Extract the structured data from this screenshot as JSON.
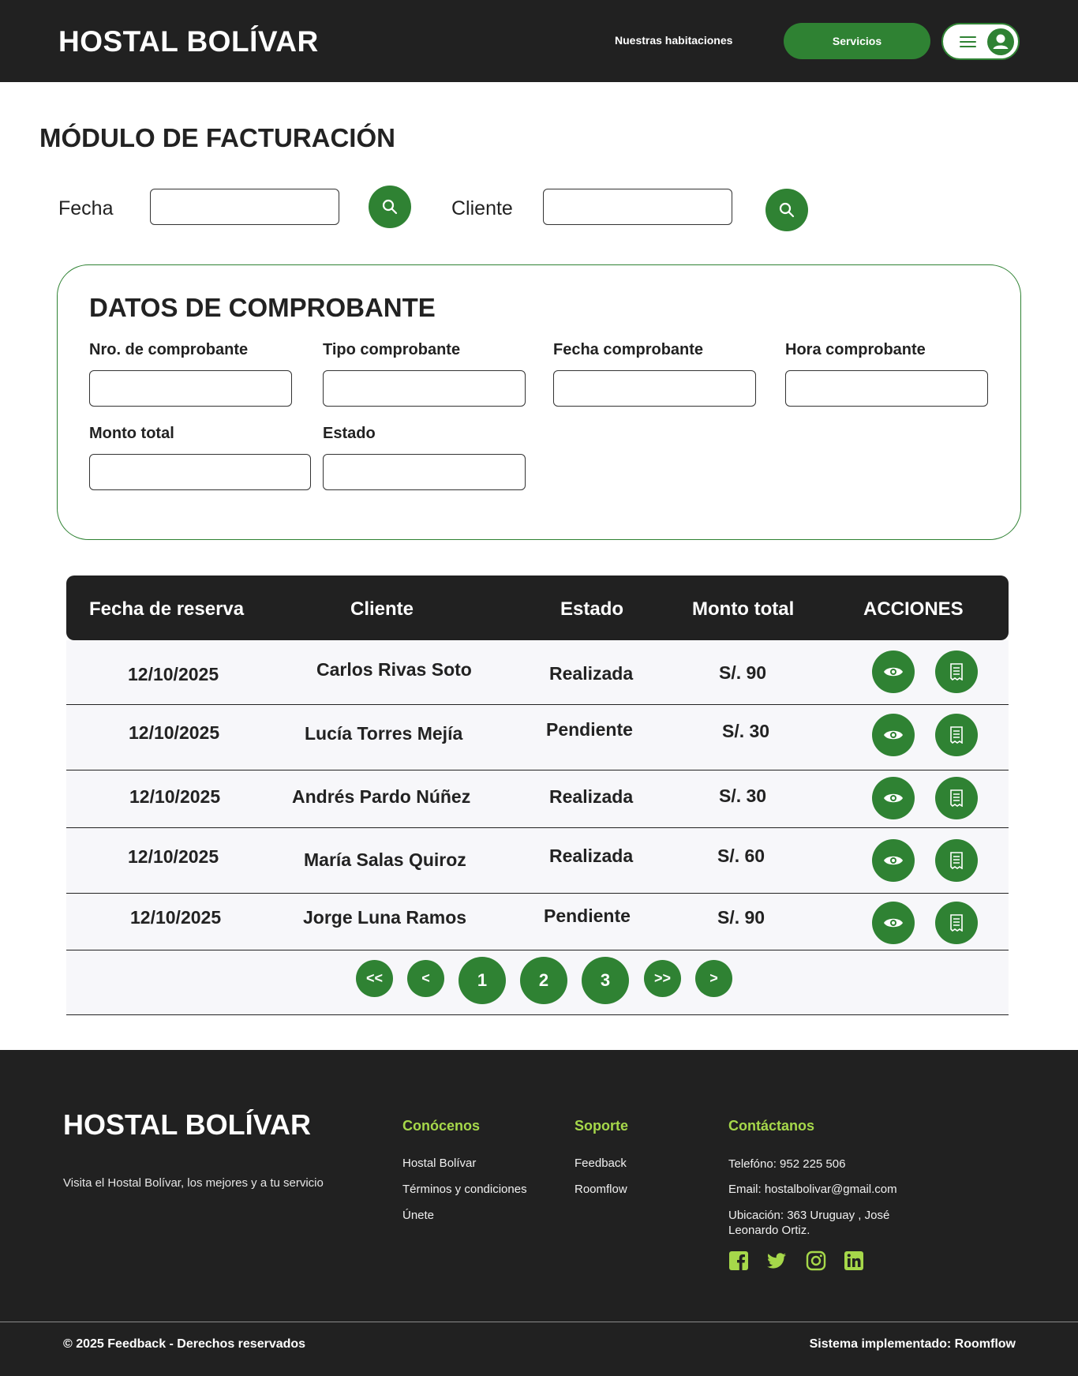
{
  "header": {
    "brand": "HOSTAL BOLÍVAR",
    "nav_rooms": "Nuestras habitaciones",
    "nav_services": "Servicios"
  },
  "page": {
    "title": "MÓDULO DE FACTURACIÓN"
  },
  "search": {
    "date_label": "Fecha",
    "date_value": "",
    "client_label": "Cliente",
    "client_value": ""
  },
  "receipt": {
    "title": "DATOS DE COMPROBANTE",
    "fields": {
      "number": "Nro. de comprobante",
      "type": "Tipo comprobante",
      "date": "Fecha comprobante",
      "time": "Hora comprobante",
      "total": "Monto total",
      "status": "Estado"
    }
  },
  "table": {
    "headers": [
      "Fecha de reserva",
      "Cliente",
      "Estado",
      "Monto total",
      "ACCIONES"
    ],
    "rows": [
      {
        "date": "12/10/2025",
        "client": "Carlos Rivas Soto",
        "status": "Realizada",
        "amount": "S/. 90"
      },
      {
        "date": "12/10/2025",
        "client": "Lucía Torres Mejía",
        "status": "Pendiente",
        "amount": "S/. 30"
      },
      {
        "date": "12/10/2025",
        "client": "Andrés Pardo Núñez",
        "status": "Realizada",
        "amount": "S/. 30"
      },
      {
        "date": "12/10/2025",
        "client": "María Salas Quiroz",
        "status": "Realizada",
        "amount": "S/. 60"
      },
      {
        "date": "12/10/2025",
        "client": "Jorge Luna Ramos",
        "status": "Pendiente",
        "amount": "S/. 90"
      }
    ],
    "row_icons": [
      "eye-icon",
      "receipt-icon"
    ]
  },
  "pagination": {
    "first": "<<",
    "prev": "<",
    "pages": [
      "1",
      "2",
      "3"
    ],
    "last": ">>",
    "next": ">"
  },
  "footer": {
    "brand": "HOSTAL BOLÍVAR",
    "tagline": "Visita el Hostal Bolívar, los mejores y a tu servicio",
    "about_title": "Conócenos",
    "about_links": [
      "Hostal Bolívar",
      "Términos y condiciones",
      "Únete"
    ],
    "support_title": "Soporte",
    "support_links": [
      "Feedback",
      "Roomflow"
    ],
    "contact_title": "Contáctanos",
    "phone": "Telefóno: 952 225 506",
    "email": "Email: hostalbolivar@gmail.com",
    "location_line1": "Ubicación: 363 Uruguay , José",
    "location_line2": "Leonardo Ortiz.",
    "social_icons": [
      "facebook-icon",
      "twitter-icon",
      "instagram-icon",
      "linkedin-icon"
    ],
    "copyright": "© 2025 Feedback - Derechos reservados",
    "system": "Sistema implementado: Roomflow"
  },
  "colors": {
    "dark": "#212121",
    "green": "#2f8233",
    "lime": "#a6d84a"
  }
}
